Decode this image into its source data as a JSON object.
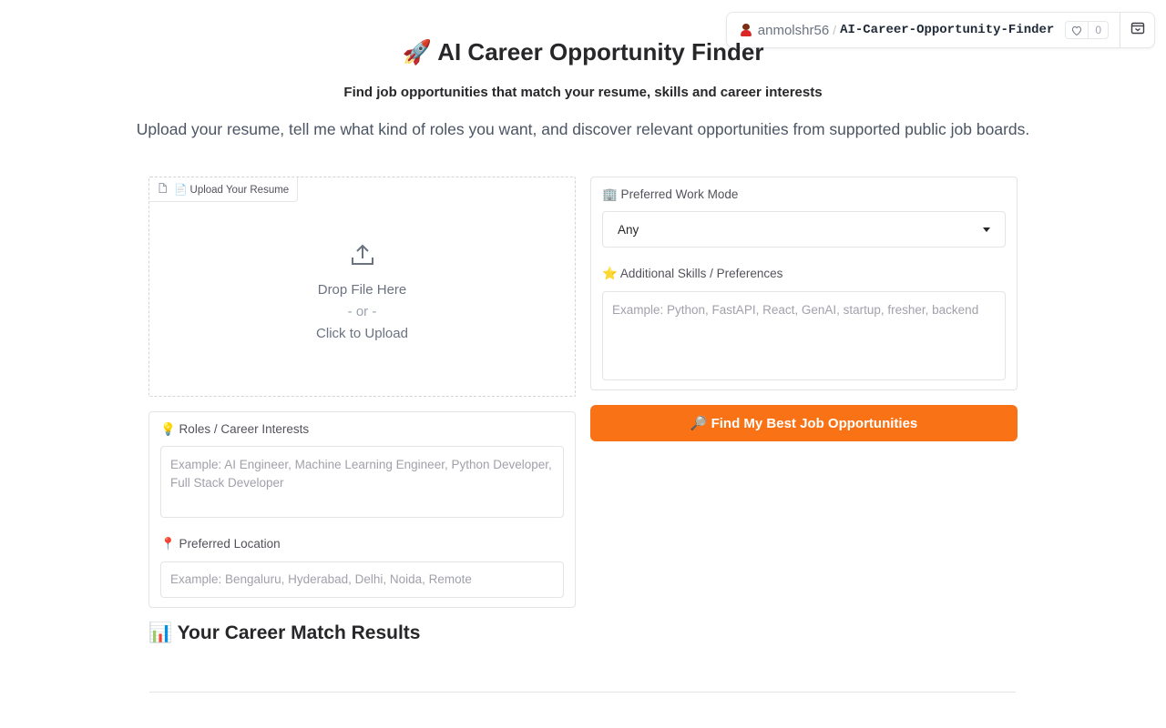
{
  "hf_badge": {
    "user": "anmolshr56",
    "separator": "/",
    "repo": "AI-Career-Opportunity-Finder",
    "likes": "0"
  },
  "header": {
    "title_emoji": "🚀",
    "title": "AI Career Opportunity Finder",
    "subtitle_plain": "Find job opportunities that match ",
    "subtitle_bold": "your resume, skills and career interests",
    "intro": "Upload your resume, tell me what kind of roles you want, and discover relevant opportunities from supported public job boards."
  },
  "upload": {
    "label": "📄 Upload Your Resume",
    "drop_text": "Drop File Here",
    "or_text": "- or -",
    "click_text": "Click to Upload"
  },
  "roles": {
    "label": "💡 Roles / Career Interests",
    "placeholder": "Example: AI Engineer, Machine Learning Engineer, Python Developer, Full Stack Developer"
  },
  "location": {
    "label": "📍 Preferred Location",
    "placeholder": "Example: Bengaluru, Hyderabad, Delhi, Noida, Remote"
  },
  "work_mode": {
    "label": "🏢 Preferred Work Mode",
    "value": "Any"
  },
  "skills": {
    "label": "⭐ Additional Skills / Preferences",
    "placeholder": "Example: Python, FastAPI, React, GenAI, startup, fresher, backend"
  },
  "find_button": {
    "label": "🔎 Find My Best Job Opportunities",
    "color": "#f97316"
  },
  "results": {
    "title": "📊 Your Career Match Results"
  },
  "icons": {
    "upload": "upload-icon",
    "file": "file-icon",
    "heart": "heart-icon",
    "collapse": "collapse-icon",
    "dropdown": "chevron-down-icon"
  }
}
